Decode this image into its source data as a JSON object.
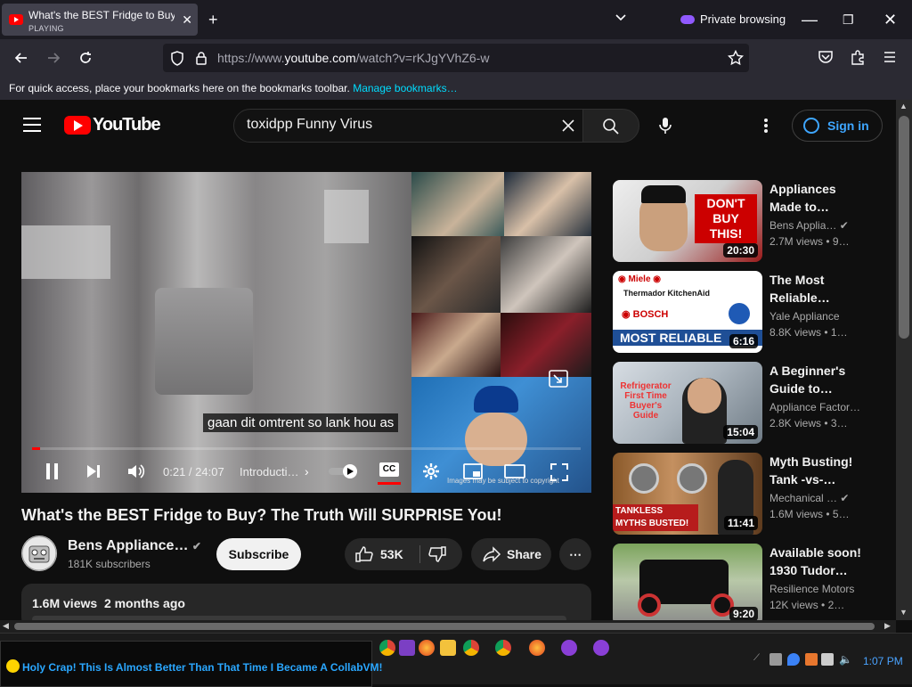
{
  "browser": {
    "tab_title": "What's the BEST Fridge to Buy? The Truth Will SURPRISE You!",
    "tab_status": "PLAYING",
    "private_label": "Private browsing",
    "url_prefix": "https://www.",
    "url_host": "youtube.com",
    "url_path": "/watch?v=rKJgYVhZ6-w",
    "bookmarks_hint": "For quick access, place your bookmarks here on the bookmarks toolbar.",
    "bookmarks_link": "Manage bookmarks…"
  },
  "youtube": {
    "logo_text": "YouTube",
    "search_value": "toxidpp Funny Virus",
    "sign_in": "Sign in"
  },
  "player": {
    "caption": "gaan dit omtrent so lank hou as",
    "time": "0:21 / 24:07",
    "chapter": "Introducti…",
    "cc_label": "CC",
    "collage_watermark": "Images may be subject to copyright",
    "progress": 0.015
  },
  "video": {
    "title": "What's the BEST Fridge to Buy? The Truth Will SURPRISE You!",
    "channel": "Bens Appliance…",
    "subscribers": "181K subscribers",
    "subscribe_label": "Subscribe",
    "likes": "53K",
    "share_label": "Share",
    "views": "1.6M views",
    "age": "2 months ago"
  },
  "recommendations": [
    {
      "title": "Appliances Made to…",
      "channel": "Bens Applia…",
      "views": "2.7M views",
      "age": "• 9…",
      "duration": "20:30",
      "verified": true,
      "thumb_text": "DON'T BUY THIS!"
    },
    {
      "title": "The Most Reliable…",
      "channel": "Yale Appliance",
      "views": "8.8K views",
      "age": "• 1…",
      "duration": "6:16",
      "verified": false,
      "thumb_text": "MOST RELIABLE"
    },
    {
      "title": "A Beginner's Guide to…",
      "channel": "Appliance Factor…",
      "views": "2.8K views",
      "age": "• 3…",
      "duration": "15:04",
      "verified": false,
      "thumb_text": "Refrigerator First Time Buyer's Guide"
    },
    {
      "title": "Myth Busting! Tank -vs-…",
      "channel": "Mechanical …",
      "views": "1.6M views",
      "age": "• 5…",
      "duration": "11:41",
      "verified": true,
      "thumb_text": "TANKLESS MYTHS BUSTED!"
    },
    {
      "title": "Available soon! 1930 Tudor…",
      "channel": "Resilience Motors",
      "views": "12K views",
      "age": "• 2…",
      "duration": "9:20",
      "verified": false,
      "thumb_text": ""
    }
  ],
  "taskbar": {
    "marquee": "Holy Crap! This Is Almost Better Than That Time I Became A CollabVM!",
    "clock": "1:07 PM"
  },
  "colors": {
    "accent_red": "#ff0000",
    "link_blue": "#3ea6ff",
    "private_purple": "#9059ff"
  }
}
